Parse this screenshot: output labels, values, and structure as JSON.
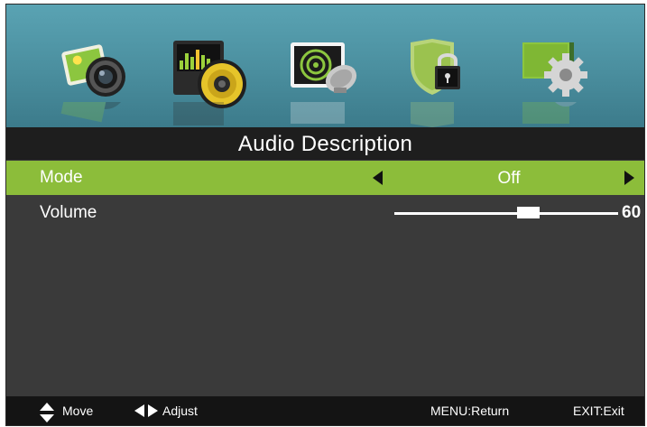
{
  "menu": {
    "icons": [
      {
        "name": "picture-icon"
      },
      {
        "name": "sound-icon"
      },
      {
        "name": "channel-icon"
      },
      {
        "name": "lock-icon"
      },
      {
        "name": "setup-icon"
      }
    ],
    "selected_index": 1
  },
  "page": {
    "title": "Audio Description"
  },
  "rows": {
    "mode": {
      "label": "Mode",
      "value": "Off"
    },
    "volume": {
      "label": "Volume",
      "value": "60",
      "level": 0.6
    }
  },
  "footer": {
    "move": "Move",
    "adjust": "Adjust",
    "menu_return": "MENU:Return",
    "exit": "EXIT:Exit"
  },
  "colors": {
    "selected_row": "#8cbd3a",
    "icon_bar": "#4a8e9e",
    "panel": "#3a3a3a"
  }
}
